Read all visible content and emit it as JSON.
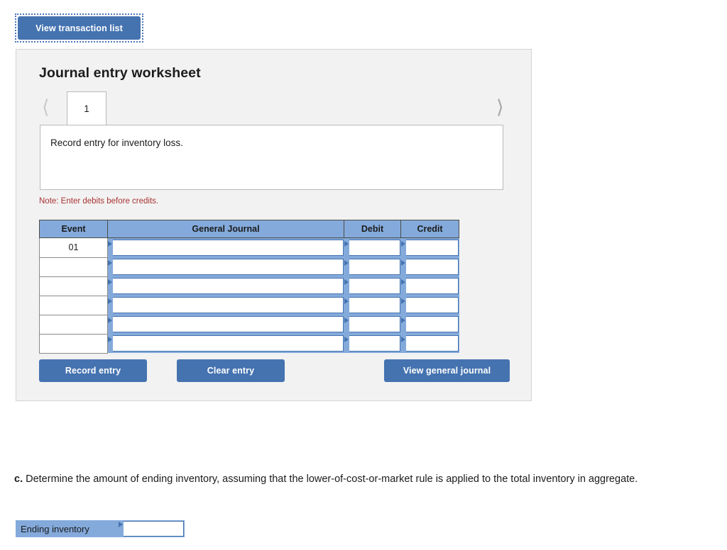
{
  "top_action": {
    "view_transaction_list_label": "View transaction list"
  },
  "worksheet": {
    "title": "Journal entry worksheet",
    "nav": {
      "prev_icon": "chevron-left-icon",
      "next_icon": "chevron-right-icon",
      "tabs": [
        {
          "label": "1",
          "active": true
        }
      ]
    },
    "description": "Record entry for inventory loss.",
    "note": "Note: Enter debits before credits.",
    "table": {
      "headers": [
        "Event",
        "General Journal",
        "Debit",
        "Credit"
      ],
      "rows": [
        {
          "event": "01",
          "general_journal": "",
          "debit": "",
          "credit": ""
        },
        {
          "event": "",
          "general_journal": "",
          "debit": "",
          "credit": ""
        },
        {
          "event": "",
          "general_journal": "",
          "debit": "",
          "credit": ""
        },
        {
          "event": "",
          "general_journal": "",
          "debit": "",
          "credit": ""
        },
        {
          "event": "",
          "general_journal": "",
          "debit": "",
          "credit": ""
        },
        {
          "event": "",
          "general_journal": "",
          "debit": "",
          "credit": ""
        }
      ]
    },
    "buttons": {
      "record_entry": "Record entry",
      "clear_entry": "Clear entry",
      "view_general_journal": "View general journal"
    }
  },
  "question_c": {
    "marker": "c.",
    "text": " Determine the amount of ending inventory, assuming that the lower-of-cost-or-market rule is applied to the total inventory in aggregate."
  },
  "ending_inventory": {
    "label": "Ending inventory",
    "value": "",
    "placeholder": ""
  },
  "colors": {
    "button_blue": "#4573b0",
    "header_blue": "#84aadb",
    "panel_gray": "#f2f2f2",
    "note_red": "#a83232"
  }
}
